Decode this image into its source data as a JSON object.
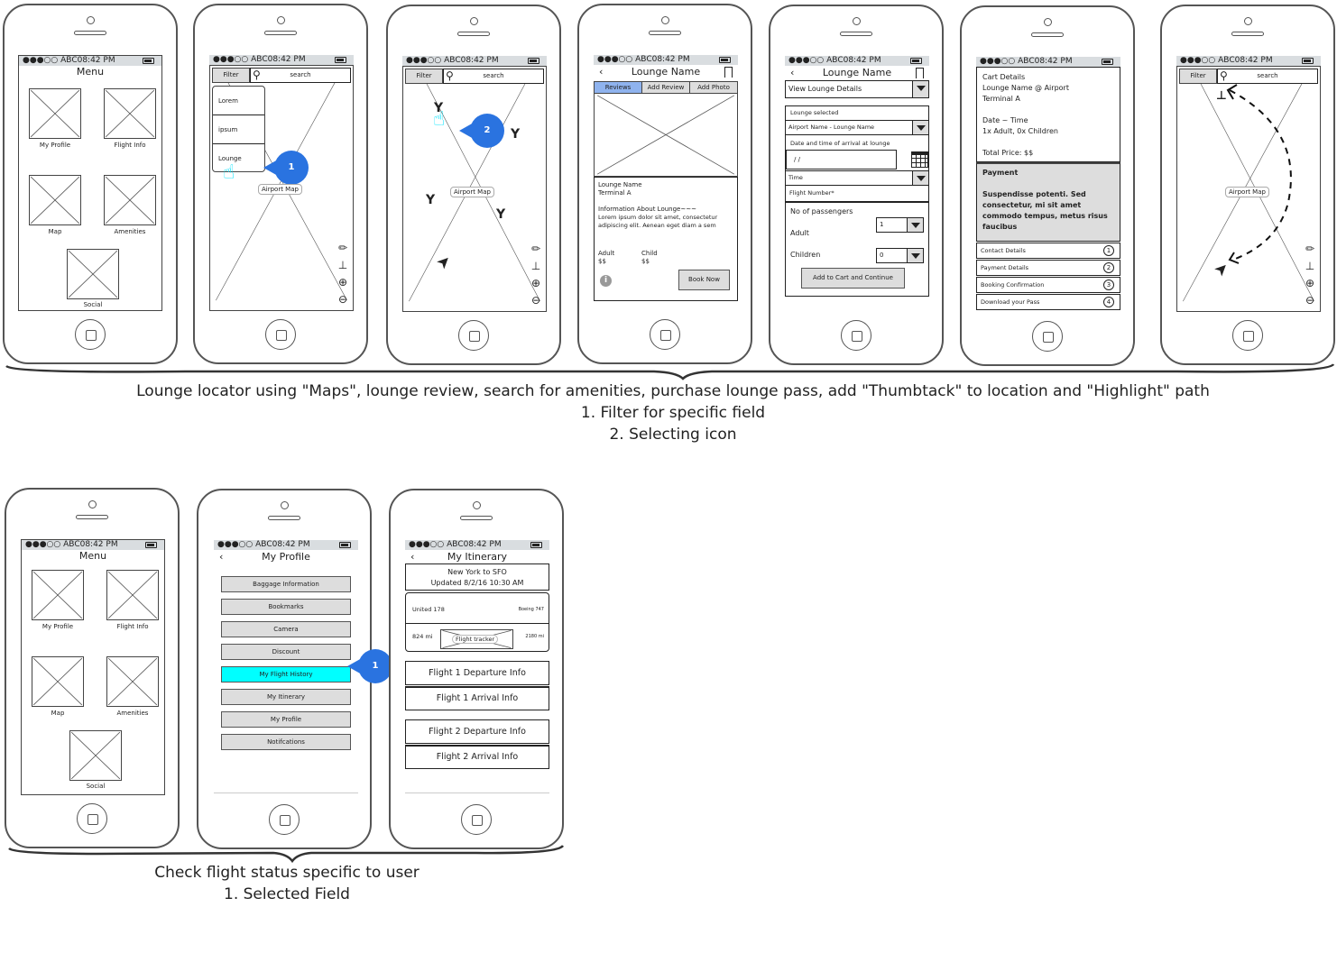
{
  "status_bar": {
    "signal": "●●●○○",
    "carrier_time": "ABC08:42 PM"
  },
  "menu_screen": {
    "title": "Menu",
    "items": [
      "My Profile",
      "Flight Info",
      "Map",
      "Amenities",
      "Social"
    ]
  },
  "map_screen": {
    "filter_label": "Filter",
    "search_placeholder": "search",
    "map_label": "Airport Map",
    "filter_options": [
      "Lorem",
      "ipsum",
      "Lounge"
    ],
    "callout_1": "1",
    "callout_2": "2",
    "tools": {
      "pencil": "✏",
      "pin": "📌",
      "zoom_in": "⊕",
      "zoom_out": "⊖"
    }
  },
  "lounge_screen": {
    "title": "Lounge Name",
    "tabs": [
      "Reviews",
      "Add Review",
      "Add Photo"
    ],
    "active_tab": "Reviews",
    "name": "Lounge Name",
    "terminal": "Terminal A",
    "info_heading": "Information About Lounge~~~",
    "info_body": "Lorem ipsum dolor sit amet, consectetur adipiscing elit. Aenean eget diam a sem",
    "adult_label": "Adult",
    "adult_price": "$$",
    "child_label": "Child",
    "child_price": "$$",
    "book_button": "Book Now"
  },
  "booking_screen": {
    "title": "Lounge Name",
    "view_details": "View Lounge Details",
    "lounge_selected_label": "Lounge selected",
    "lounge_selected_value": "Airport Name - Lounge Name",
    "date_label": "Date and time of arrival at lounge",
    "date_value": " / /",
    "time_label": "Time",
    "flight_number_label": "Flight Number*",
    "passengers_label": "No of passengers",
    "adult_label": "Adult",
    "adult_value": "1",
    "children_label": "Children",
    "children_value": "0",
    "submit_button": "Add to Cart and Continue"
  },
  "cart_screen": {
    "heading": "Cart Details",
    "lounge": "Lounge Name @ Airport",
    "terminal": "Terminal A",
    "date_time": "Date ~ Time",
    "passengers": "1x Adult, 0x Children",
    "total": "Total Price: $$",
    "payment_heading": "Payment",
    "payment_body": "Suspendisse potenti. Sed consectetur, mi sit amet commodo tempus, metus risus faucibus",
    "steps": [
      {
        "label": "Contact Details",
        "num": "1"
      },
      {
        "label": "Payment Details",
        "num": "2"
      },
      {
        "label": "Booking Confirmation",
        "num": "3"
      },
      {
        "label": "Download your Pass",
        "num": "4"
      }
    ]
  },
  "profile_screen": {
    "title": "My Profile",
    "items": [
      "Baggage Information",
      "Bookmarks",
      "Camera",
      "Discount",
      "My Flight History",
      "My Itinerary",
      "My Profile",
      "Notifcations"
    ],
    "selected": "My Flight History",
    "callout": "1"
  },
  "itinerary_screen": {
    "title": "My Itinerary",
    "route": "New York to SFO",
    "updated": "Updated 8/2/16 10:30 AM",
    "airline": "United 178",
    "aircraft": "Boeing 747",
    "distance_flown": "824 mi",
    "tracker_label": "Flight tracker",
    "distance_remaining": "2180 mi",
    "sections": [
      "Flight 1 Departure Info",
      "Flight 1 Arrival Info",
      "Flight 2 Departure Info",
      "Flight 2 Arrival Info"
    ]
  },
  "captions": {
    "top": [
      "Lounge locator using \"Maps\", lounge review, search for amenities, purchase lounge pass, add \"Thumbtack\" to location and \"Highlight\" path",
      "1. Filter for specific field",
      "2. Selecting icon"
    ],
    "bottom": [
      "Check flight status specific to user",
      "1. Selected Field"
    ]
  },
  "colors": {
    "highlight": "#00ffff",
    "callout": "#2a73e0",
    "active_tab": "#8fb3ee",
    "button_gray": "#dddddd"
  }
}
